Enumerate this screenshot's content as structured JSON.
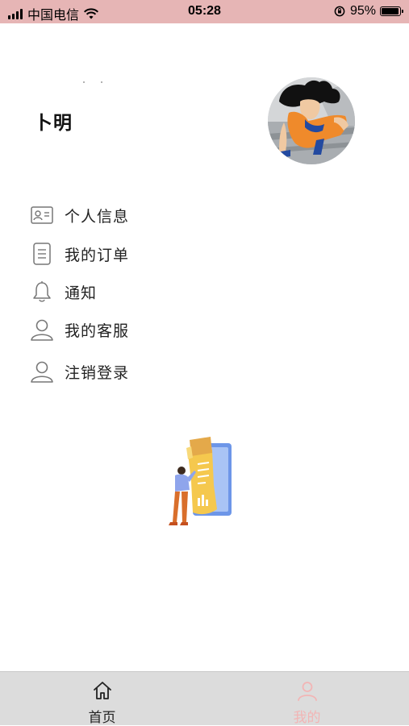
{
  "status_bar": {
    "carrier": "中国电信",
    "time": "05:28",
    "battery_percent": "95%",
    "battery_level": 0.95,
    "signal_bars": 4,
    "icons": [
      "signal-icon",
      "wifi-icon",
      "rotation-lock-icon",
      "battery-icon"
    ]
  },
  "profile": {
    "username": "卜明",
    "avatar_alt": "avatar"
  },
  "menu": {
    "items": [
      {
        "label": "个人信息",
        "icon": "id-card-icon"
      },
      {
        "label": "我的订单",
        "icon": "document-icon"
      },
      {
        "label": "通知",
        "icon": "bell-icon"
      },
      {
        "label": "我的客服",
        "icon": "user-icon"
      },
      {
        "label": "注销登录",
        "icon": "user-icon"
      }
    ]
  },
  "tab_bar": {
    "tabs": [
      {
        "label": "首页",
        "icon": "home-icon",
        "active": false
      },
      {
        "label": "我的",
        "icon": "user-icon",
        "active": true
      }
    ],
    "colors": {
      "active": "#f2b5b5",
      "inactive": "#222222"
    }
  },
  "colors": {
    "status_bar_bg": "#e6b5b5",
    "tab_bar_bg": "#dcdcdc"
  }
}
